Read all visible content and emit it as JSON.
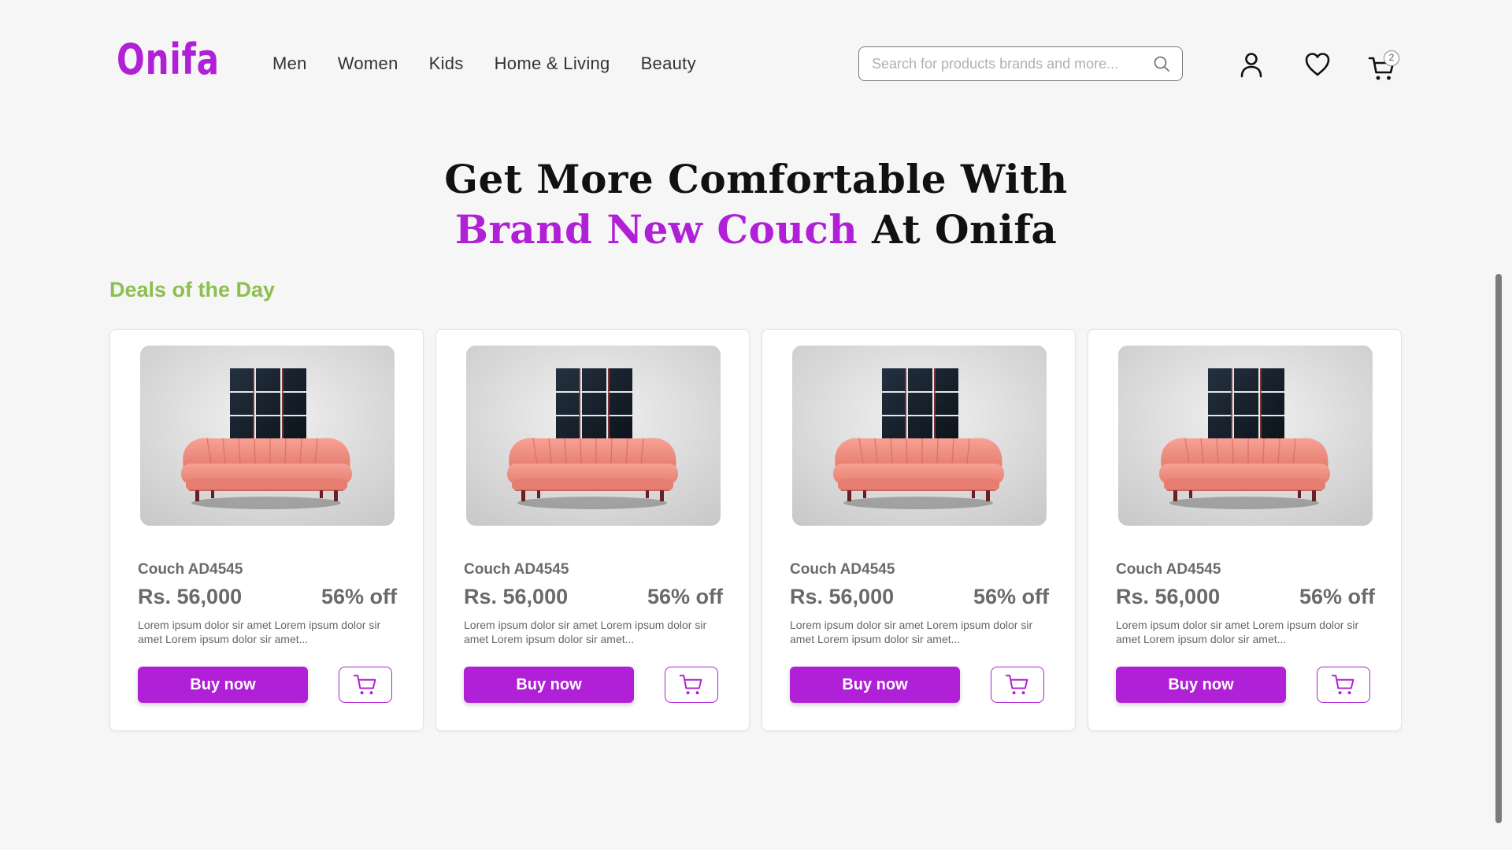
{
  "brand": {
    "logo": "Onifa",
    "accent_color": "#b020d6"
  },
  "nav": {
    "items": [
      {
        "label": "Men"
      },
      {
        "label": "Women"
      },
      {
        "label": "Kids"
      },
      {
        "label": "Home & Living"
      },
      {
        "label": "Beauty"
      }
    ]
  },
  "search": {
    "placeholder": "Search for products brands and more...",
    "icon": "search-icon"
  },
  "header_icons": {
    "account": "user-icon",
    "wishlist": "heart-icon",
    "cart": "cart-icon",
    "cart_count": "2"
  },
  "hero": {
    "line1": "Get More Comfortable With",
    "line2_accent": "Brand New Couch",
    "line2_rest": " At Onifa"
  },
  "deals": {
    "title": "Deals of the Day",
    "title_color": "#8cbf4f",
    "products": [
      {
        "name": "Couch AD4545",
        "price": "Rs. 56,000",
        "discount": "56% off",
        "description": "Lorem ipsum dolor sir amet Lorem ipsum dolor sir amet Lorem ipsum dolor sir amet...",
        "buy_label": "Buy now",
        "cart_icon": "cart-icon"
      },
      {
        "name": "Couch AD4545",
        "price": "Rs. 56,000",
        "discount": "56% off",
        "description": "Lorem ipsum dolor sir amet Lorem ipsum dolor sir amet Lorem ipsum dolor sir amet...",
        "buy_label": "Buy now",
        "cart_icon": "cart-icon"
      },
      {
        "name": "Couch AD4545",
        "price": "Rs. 56,000",
        "discount": "56% off",
        "description": "Lorem ipsum dolor sir amet Lorem ipsum dolor sir amet Lorem ipsum dolor sir amet...",
        "buy_label": "Buy now",
        "cart_icon": "cart-icon"
      },
      {
        "name": "Couch AD4545",
        "price": "Rs. 56,000",
        "discount": "56% off",
        "description": "Lorem ipsum dolor sir amet Lorem ipsum dolor sir amet Lorem ipsum dolor sir amet...",
        "buy_label": "Buy now",
        "cart_icon": "cart-icon"
      }
    ]
  }
}
